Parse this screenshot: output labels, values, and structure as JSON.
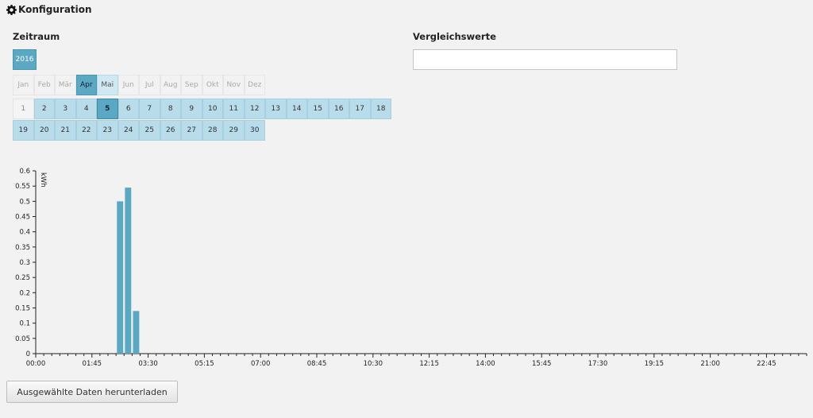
{
  "header": {
    "title": "Konfiguration",
    "icon": "gear-icon"
  },
  "zeitraum": {
    "title": "Zeitraum",
    "year": "2016",
    "months": [
      {
        "label": "Jan",
        "state": "unavailable"
      },
      {
        "label": "Feb",
        "state": "unavailable"
      },
      {
        "label": "Mär",
        "state": "unavailable"
      },
      {
        "label": "Apr",
        "state": "selected"
      },
      {
        "label": "Mai",
        "state": "available"
      },
      {
        "label": "Jun",
        "state": "unavailable"
      },
      {
        "label": "Jul",
        "state": "unavailable"
      },
      {
        "label": "Aug",
        "state": "unavailable"
      },
      {
        "label": "Sep",
        "state": "unavailable"
      },
      {
        "label": "Okt",
        "state": "unavailable"
      },
      {
        "label": "Nov",
        "state": "unavailable"
      },
      {
        "label": "Dez",
        "state": "unavailable"
      }
    ],
    "days": [
      {
        "label": "1",
        "state": "unavailable"
      },
      {
        "label": "2",
        "state": "available"
      },
      {
        "label": "3",
        "state": "available"
      },
      {
        "label": "4",
        "state": "available"
      },
      {
        "label": "5",
        "state": "selected"
      },
      {
        "label": "6",
        "state": "available"
      },
      {
        "label": "7",
        "state": "available"
      },
      {
        "label": "8",
        "state": "available"
      },
      {
        "label": "9",
        "state": "available"
      },
      {
        "label": "10",
        "state": "available"
      },
      {
        "label": "11",
        "state": "available"
      },
      {
        "label": "12",
        "state": "available"
      },
      {
        "label": "13",
        "state": "available"
      },
      {
        "label": "14",
        "state": "available"
      },
      {
        "label": "15",
        "state": "available"
      },
      {
        "label": "16",
        "state": "available"
      },
      {
        "label": "17",
        "state": "available"
      },
      {
        "label": "18",
        "state": "available"
      },
      {
        "label": "19",
        "state": "available"
      },
      {
        "label": "20",
        "state": "available"
      },
      {
        "label": "21",
        "state": "available"
      },
      {
        "label": "22",
        "state": "available"
      },
      {
        "label": "23",
        "state": "available"
      },
      {
        "label": "24",
        "state": "available"
      },
      {
        "label": "25",
        "state": "available"
      },
      {
        "label": "26",
        "state": "available"
      },
      {
        "label": "27",
        "state": "available"
      },
      {
        "label": "28",
        "state": "available"
      },
      {
        "label": "29",
        "state": "available"
      },
      {
        "label": "30",
        "state": "available"
      }
    ]
  },
  "vergleichswerte": {
    "title": "Vergleichswerte",
    "value": ""
  },
  "download": {
    "label": "Ausgewählte Daten herunterladen"
  },
  "colors": {
    "bar": "#5aa8c3",
    "selected": "#5aa8c3",
    "available": "#b8dce9"
  },
  "chart_data": {
    "type": "bar",
    "title": "",
    "xlabel": "",
    "ylabel": "kWh",
    "ylim": [
      0,
      0.6
    ],
    "yticks": [
      "0",
      "0.05",
      "0.1",
      "0.15",
      "0.2",
      "0.25",
      "0.3",
      "0.35",
      "0.4",
      "0.45",
      "0.5",
      "0.55",
      "0.6"
    ],
    "xlim": [
      "00:00",
      "24:00"
    ],
    "x_interval_minutes": 15,
    "xtick_labels": [
      "00:00",
      "01:45",
      "03:30",
      "05:15",
      "07:00",
      "08:45",
      "10:30",
      "12:15",
      "14:00",
      "15:45",
      "17:30",
      "19:15",
      "21:00",
      "22:45"
    ],
    "x": [
      "02:30",
      "02:45",
      "03:00"
    ],
    "values": [
      0.5,
      0.545,
      0.14
    ],
    "grid": false,
    "legend": "none"
  }
}
